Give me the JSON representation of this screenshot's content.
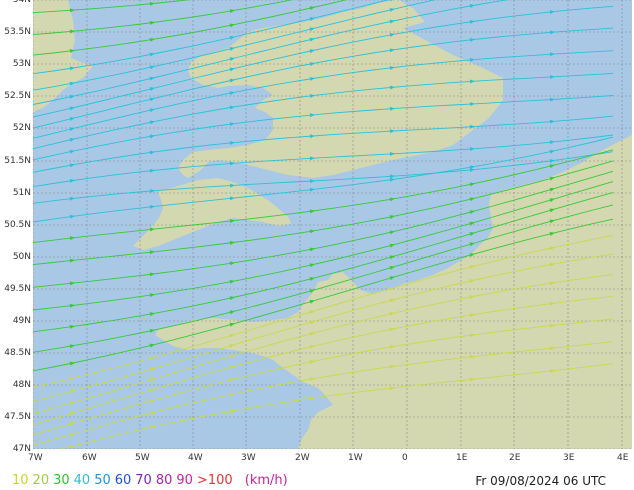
{
  "map": {
    "lat_labels": [
      "54N",
      "53.5N",
      "53N",
      "52.5N",
      "52N",
      "51.5N",
      "51N",
      "50.5N",
      "50N",
      "49.5N",
      "49N",
      "48.5N",
      "48N",
      "47.5N",
      "47N"
    ],
    "lon_labels": [
      "7W",
      "6W",
      "5W",
      "4W",
      "3W",
      "2W",
      "1W",
      "0",
      "1E",
      "2E",
      "3E",
      "4E"
    ],
    "colors": {
      "sea": "#a9c8e6",
      "land": "#d4d8b0",
      "grid": "#888888",
      "stream_slow": "#c8d850",
      "stream_mid": "#38c838",
      "stream_fast": "#2cc0d8"
    }
  },
  "legend": {
    "items": [
      {
        "label": "10",
        "color": "#c8d820"
      },
      {
        "label": "20",
        "color": "#a0d040"
      },
      {
        "label": "30",
        "color": "#28c828"
      },
      {
        "label": "40",
        "color": "#30c0c8"
      },
      {
        "label": "50",
        "color": "#1f90e0"
      },
      {
        "label": "60",
        "color": "#2050e0"
      },
      {
        "label": "70",
        "color": "#8020c0"
      },
      {
        "label": "80",
        "color": "#b020b0"
      },
      {
        "label": "90",
        "color": "#d020a0"
      },
      {
        "label": ">100",
        "color": "#f03030"
      }
    ],
    "unit": "(km/h)",
    "unit_color": "#d020a0"
  },
  "timestamp": "Fr 09/08/2024 06 UTC"
}
